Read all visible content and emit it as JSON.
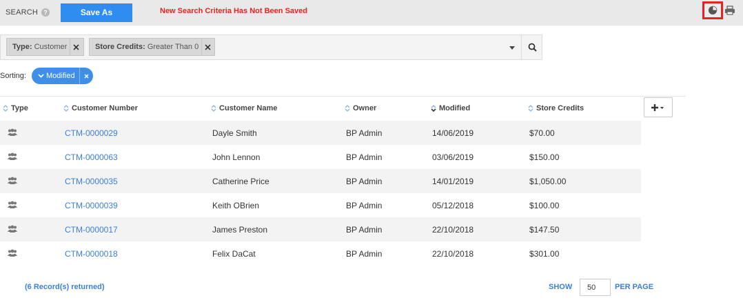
{
  "topbar": {
    "search_label": "SEARCH",
    "help_icon": "?",
    "save_as_label": "Save As",
    "warning_text": "New Search Criteria Has Not Been Saved",
    "chart_icon": "pie-chart-icon",
    "print_icon": "print-icon"
  },
  "filters": [
    {
      "key": "Type",
      "value": "Customer"
    },
    {
      "key": "Store Credits",
      "value": "Greater Than 0"
    }
  ],
  "sorting": {
    "label": "Sorting:",
    "pill_label": "Modified"
  },
  "table": {
    "columns": [
      "Type",
      "Customer Number",
      "Customer Name",
      "Owner",
      "Modified",
      "Store Credits"
    ],
    "rows": [
      {
        "type": "customer-group-icon",
        "number": "CTM-0000029",
        "name": "Dayle Smith",
        "owner": "BP Admin",
        "modified": "14/06/2019",
        "credits": "$70.00"
      },
      {
        "type": "customer-group-icon",
        "number": "CTM-0000063",
        "name": "John Lennon",
        "owner": "BP Admin",
        "modified": "03/06/2019",
        "credits": "$150.00"
      },
      {
        "type": "customer-group-icon",
        "number": "CTM-0000035",
        "name": "Catherine Price",
        "owner": "BP Admin",
        "modified": "14/01/2019",
        "credits": "$1,050.00"
      },
      {
        "type": "customer-group-icon",
        "number": "CTM-0000039",
        "name": "Keith OBrien",
        "owner": "BP Admin",
        "modified": "05/12/2018",
        "credits": "$100.00"
      },
      {
        "type": "customer-group-icon",
        "number": "CTM-0000017",
        "name": "James Preston",
        "owner": "BP Admin",
        "modified": "22/10/2018",
        "credits": "$147.50"
      },
      {
        "type": "customer-group-icon",
        "number": "CTM-0000018",
        "name": "Felix DaCat",
        "owner": "BP Admin",
        "modified": "22/10/2018",
        "credits": "$301.00"
      }
    ]
  },
  "footer": {
    "records_text": "(6 Record(s) returned)",
    "show_label": "SHOW",
    "page_size": "50",
    "per_page_label": "PER PAGE"
  },
  "colors": {
    "accent": "#2f8cf0",
    "warning": "#e8231f",
    "link": "#3b7fd9"
  }
}
